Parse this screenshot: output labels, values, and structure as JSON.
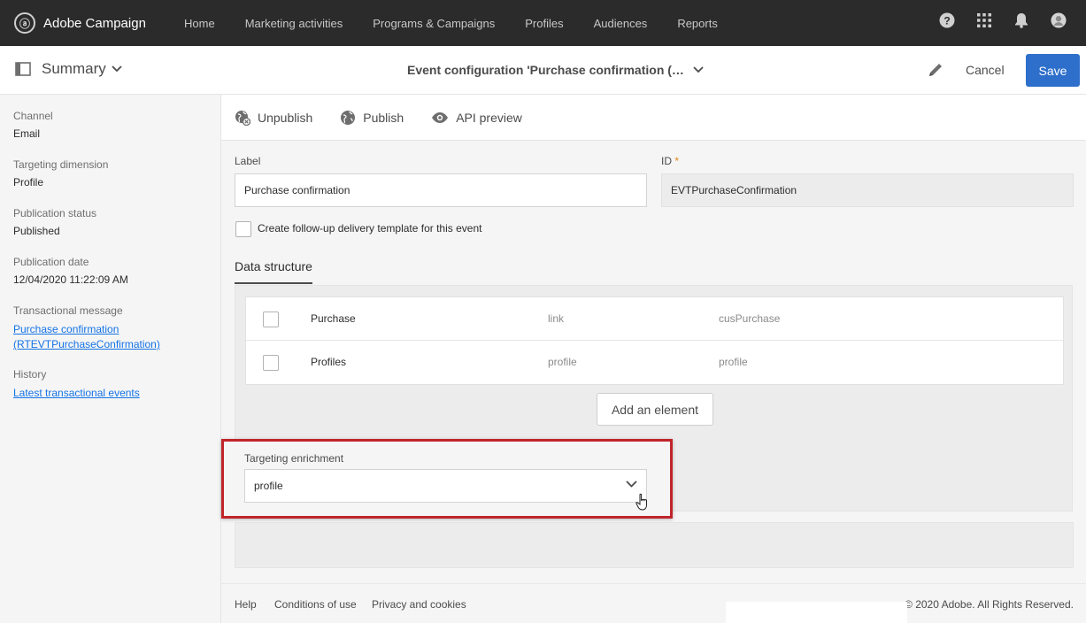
{
  "app": {
    "name": "Adobe Campaign"
  },
  "nav": [
    "Home",
    "Marketing activities",
    "Programs & Campaigns",
    "Profiles",
    "Audiences",
    "Reports"
  ],
  "top_icons": [
    "help-icon",
    "apps-grid-icon",
    "bell-icon",
    "user-avatar-icon"
  ],
  "header": {
    "summary_label": "Summary",
    "title": "Event configuration 'Purchase confirmation (…",
    "cancel_label": "Cancel",
    "save_label": "Save"
  },
  "summary": {
    "channel_label": "Channel",
    "channel_value": "Email",
    "targeting_label": "Targeting dimension",
    "targeting_value": "Profile",
    "pub_status_label": "Publication status",
    "pub_status_value": "Published",
    "pub_date_label": "Publication date",
    "pub_date_value": "12/04/2020 11:22:09 AM",
    "tm_label": "Transactional message",
    "tm_link_line1": "Purchase confirmation",
    "tm_link_line2": "(RTEVTPurchaseConfirmation)",
    "history_label": "History",
    "history_link": "Latest transactional events"
  },
  "toolbar": {
    "unpublish": "Unpublish",
    "publish": "Publish",
    "api_preview": "API preview"
  },
  "form": {
    "label_label": "Label",
    "label_value": "Purchase confirmation",
    "id_label": "ID",
    "id_required": "*",
    "id_value": "EVTPurchaseConfirmation",
    "followup_label": "Create follow-up delivery template for this event"
  },
  "data_structure": {
    "tab_label": "Data structure",
    "rows": [
      {
        "name": "Purchase",
        "type": "link",
        "target": "cusPurchase"
      },
      {
        "name": "Profiles",
        "type": "profile",
        "target": "profile"
      }
    ],
    "add_label": "Add an element"
  },
  "enrichment": {
    "label": "Targeting enrichment",
    "selected": "profile"
  },
  "footer": {
    "help": "Help",
    "conditions": "Conditions of use",
    "privacy": "Privacy and cookies",
    "copyright": "© 2020 Adobe. All Rights Reserved."
  },
  "colors": {
    "topbar": "#2b2b2b",
    "accent": "#2d6fcb",
    "highlight": "#c0252a",
    "link": "#1473e6"
  }
}
